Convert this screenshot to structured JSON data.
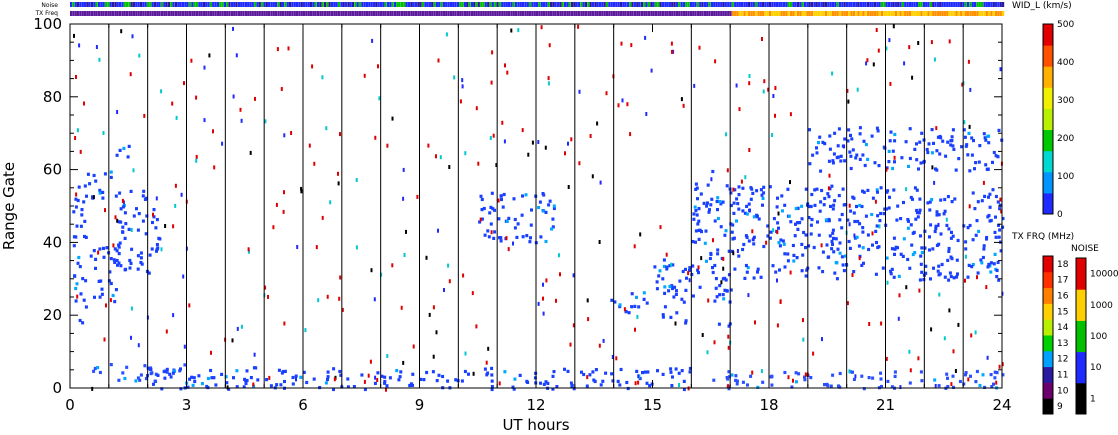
{
  "chart_data": {
    "type": "heatmap",
    "xlabel": "UT hours",
    "ylabel": "Range Gate",
    "xlim": [
      0,
      24
    ],
    "ylim": [
      0,
      100
    ],
    "xticks": [
      "0",
      "3",
      "6",
      "9",
      "12",
      "15",
      "18",
      "21",
      "24"
    ],
    "yticks": [
      "0",
      "20",
      "40",
      "60",
      "80",
      "100"
    ],
    "strip_labels": {
      "noise": "Noise",
      "txfreq": "TX Freq"
    },
    "vertical_marker_hours": [
      1.0,
      2.0,
      3.0,
      4.0,
      5.0,
      6.0,
      7.0,
      8.0,
      9.0,
      10.0,
      11.0,
      12.0,
      13.0,
      14.0,
      16.0,
      17.0,
      18.0,
      19.0,
      20.0,
      21.0,
      22.0,
      23.0
    ],
    "txfreq_change_hour": 17.0,
    "scatter_regions": [
      {
        "t0": 0.0,
        "t1": 0.4,
        "g0": 18,
        "g1": 56,
        "color": "#1a40ff"
      },
      {
        "t0": 0.4,
        "t1": 1.2,
        "g0": 24,
        "g1": 40,
        "color": "#1a40ff"
      },
      {
        "t0": 1.2,
        "t1": 2.3,
        "g0": 32,
        "g1": 56,
        "color": "#1a40ff"
      },
      {
        "t0": 0.4,
        "t1": 1.2,
        "g0": 52,
        "g1": 60,
        "color": "#1a40ff"
      },
      {
        "t0": 1.1,
        "t1": 1.5,
        "g0": 62,
        "g1": 68,
        "color": "#1a40ff"
      },
      {
        "t0": 0.5,
        "t1": 3.0,
        "g0": 2,
        "g1": 7,
        "color": "#2a4fff"
      },
      {
        "t0": 2.0,
        "t1": 16.0,
        "g0": 0,
        "g1": 6,
        "color": "#1a40ff"
      },
      {
        "t0": 10.5,
        "t1": 12.5,
        "g0": 40,
        "g1": 54,
        "color": "#1a40ff"
      },
      {
        "t0": 13.9,
        "t1": 15.0,
        "g0": 21,
        "g1": 27,
        "color": "#1a40ff"
      },
      {
        "t0": 15.0,
        "t1": 16.0,
        "g0": 18,
        "g1": 36,
        "color": "#1a40ff"
      },
      {
        "t0": 16.0,
        "t1": 17.0,
        "g0": 24,
        "g1": 60,
        "color": "#1a40ff"
      },
      {
        "t0": 16.6,
        "t1": 17.0,
        "g0": 17,
        "g1": 20,
        "color": "#1a40ff"
      },
      {
        "t0": 17.0,
        "t1": 22.0,
        "g0": 30,
        "g1": 56,
        "color": "#1a40ff"
      },
      {
        "t0": 22.0,
        "t1": 24.0,
        "g0": 30,
        "g1": 55,
        "color": "#1a40ff"
      },
      {
        "t0": 16.5,
        "t1": 24.0,
        "g0": 0,
        "g1": 5,
        "color": "#2a4fff"
      },
      {
        "t0": 19.0,
        "t1": 24.0,
        "g0": 60,
        "g1": 72,
        "color": "#1a40ff"
      }
    ],
    "colorbars": {
      "width": {
        "label": "WID_L (km/s)",
        "ticks": [
          "0",
          "100",
          "200",
          "300",
          "400",
          "500"
        ],
        "colors": [
          "#1e2aff",
          "#0094ff",
          "#00d8d0",
          "#00c800",
          "#b8f000",
          "#f0f000",
          "#ffb000",
          "#ff5000",
          "#e00000"
        ]
      },
      "txfreq": {
        "label": "TX FRQ (MHz)",
        "ticks": [
          "9",
          "10",
          "11",
          "12",
          "13",
          "14",
          "15",
          "16",
          "17",
          "18"
        ],
        "colors": [
          "#000000",
          "#6a006a",
          "#2a1aa0",
          "#00a0ff",
          "#00d000",
          "#b8f000",
          "#ffd000",
          "#ff8000",
          "#ff3000",
          "#e00000"
        ]
      },
      "noise": {
        "label": "NOISE",
        "ticks": [
          "1",
          "10",
          "100",
          "1000",
          "10000"
        ],
        "colors": [
          "#000000",
          "#1e2aff",
          "#00c000",
          "#ffd000",
          "#e00000"
        ]
      }
    }
  }
}
